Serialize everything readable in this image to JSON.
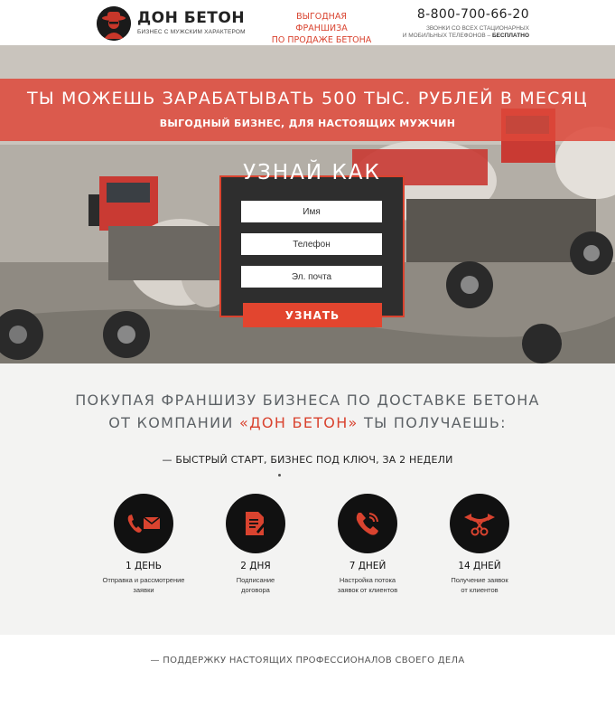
{
  "header": {
    "brand_name": "ДОН БЕТОН",
    "brand_tagline": "БИЗНЕС С МУЖСКИМ ХАРАКТЕРОМ",
    "promo_line1": "ВЫГОДНАЯ ФРАНШИЗА",
    "promo_line2": "ПО ПРОДАЖЕ БЕТОНА",
    "phone": "8-800-700-66-20",
    "phone_note_line1": "ЗВОНКИ СО ВСЕХ СТАЦИОНАРНЫХ",
    "phone_note_line2": "И МОБИЛЬНЫХ ТЕЛЕФОНОВ –",
    "phone_note_free": "БЕСПЛАТНО"
  },
  "hero": {
    "title": "ТЫ МОЖЕШЬ ЗАРАБАТЫВАТЬ 500 ТЫС. РУБЛЕЙ В МЕСЯЦ",
    "subtitle": "ВЫГОДНЫЙ БИЗНЕС, ДЛЯ НАСТОЯЩИХ МУЖЧИН"
  },
  "form": {
    "title": "УЗНАЙ КАК",
    "name_placeholder": "Имя",
    "phone_placeholder": "Телефон",
    "email_placeholder": "Эл. почта",
    "submit_label": "УЗНАТЬ"
  },
  "benefits": {
    "heading_line1": "ПОКУПАЯ ФРАНШИЗУ БИЗНЕСА ПО ДОСТАВКЕ БЕТОНА",
    "heading_line2_pre": "ОТ КОМПАНИИ ",
    "heading_line2_accent": "«ДОН БЕТОН»",
    "heading_line2_post": " ТЫ ПОЛУЧАЕШЬ:",
    "subheading": "— БЫСТРЫЙ СТАРТ, БИЗНЕС ПОД КЛЮЧ, ЗА 2 НЕДЕЛИ",
    "steps": [
      {
        "days": "1 ДЕНЬ",
        "desc_line1": "Отправка и рассмотрение",
        "desc_line2": "заявки",
        "icon": "phone-mail-icon"
      },
      {
        "days": "2 ДНЯ",
        "desc_line1": "Подписание",
        "desc_line2": "договора",
        "icon": "document-sign-icon"
      },
      {
        "days": "7 ДНЕЙ",
        "desc_line1": "Настройка потока",
        "desc_line2": "заявок от клиентов",
        "icon": "phone-call-icon"
      },
      {
        "days": "14 ДНЕЙ",
        "desc_line1": "Получение заявок",
        "desc_line2": "от клиентов",
        "icon": "ribbon-scissors-icon"
      }
    ]
  },
  "bottom": {
    "text": "— ПОДДЕРЖКУ НАСТОЯЩИХ ПРОФЕССИОНАЛОВ СВОЕГО ДЕЛА"
  },
  "colors": {
    "accent": "#d9432f",
    "dark": "#111111",
    "heading_gray": "#5d6266"
  }
}
